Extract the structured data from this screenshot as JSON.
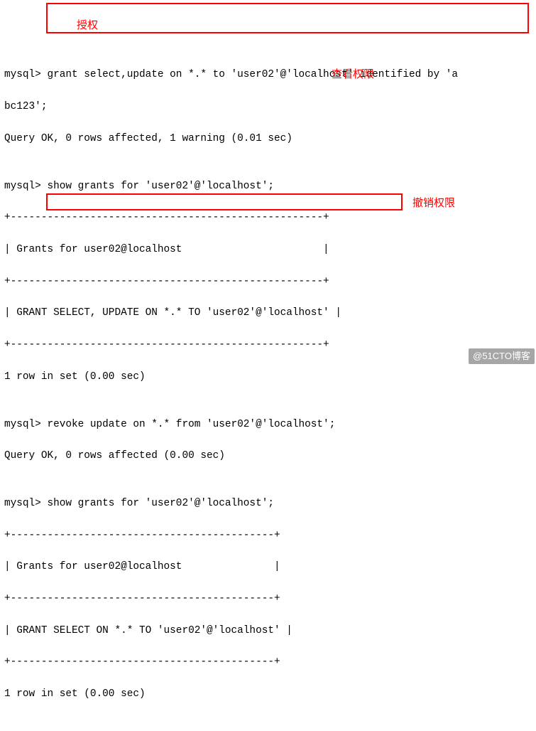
{
  "terminal": {
    "line1": "mysql> grant select,update on *.* to 'user02'@'localhost' identified by 'a",
    "line2": "bc123';",
    "line3": "Query OK, 0 rows affected, 1 warning (0.01 sec)",
    "blank1": "",
    "line4": "mysql> show grants for 'user02'@'localhost';",
    "sep1": "+---------------------------------------------------+",
    "line5": "| Grants for user02@localhost                       |",
    "sep2": "+---------------------------------------------------+",
    "line6": "| GRANT SELECT, UPDATE ON *.* TO 'user02'@'localhost' |",
    "sep3": "+---------------------------------------------------+",
    "line7": "1 row in set (0.00 sec)",
    "blank2": "",
    "line8": "mysql> revoke update on *.* from 'user02'@'localhost';",
    "line9": "Query OK, 0 rows affected (0.00 sec)",
    "blank3": "",
    "line10": "mysql> show grants for 'user02'@'localhost';",
    "sep4": "+-------------------------------------------+",
    "line11": "| Grants for user02@localhost               |",
    "sep5": "+-------------------------------------------+",
    "line12": "| GRANT SELECT ON *.* TO 'user02'@'localhost' |",
    "sep6": "+-------------------------------------------+",
    "line13": "1 row in set (0.00 sec)"
  },
  "annotations": {
    "label_grant": "授权",
    "label_show": "查看权限",
    "label_revoke": "撤销权限"
  },
  "watermark": "@51CTO博客"
}
